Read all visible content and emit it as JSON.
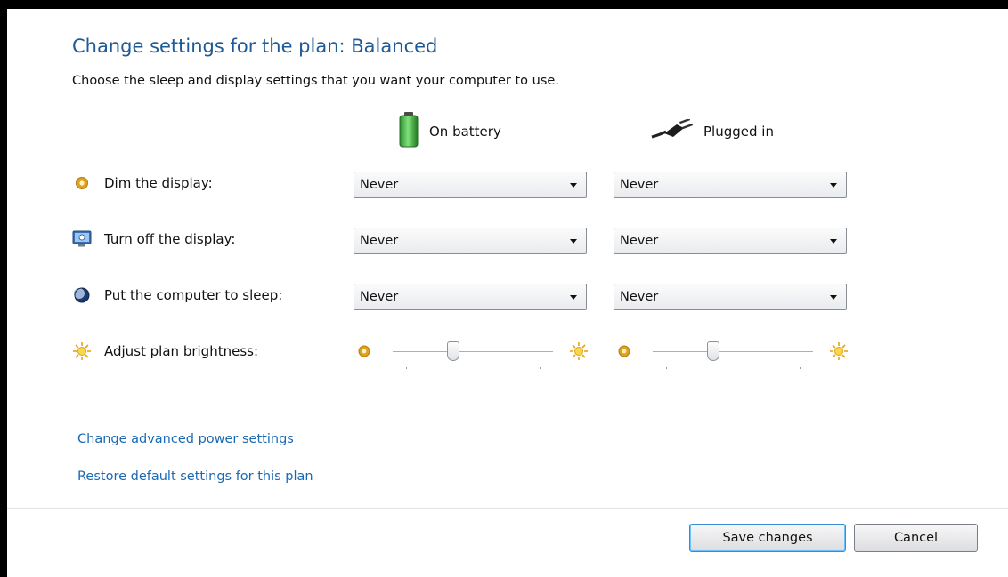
{
  "header": {
    "title": "Change settings for the plan: Balanced",
    "subtitle": "Choose the sleep and display settings that you want your computer to use."
  },
  "columns": {
    "battery": {
      "label": "On battery",
      "icon": "battery-icon"
    },
    "plugged": {
      "label": "Plugged in",
      "icon": "power-plug-icon"
    }
  },
  "rows": [
    {
      "label": "Dim the display:",
      "icon": "dim-display-icon",
      "battery_value": "Never",
      "plugged_value": "Never"
    },
    {
      "label": "Turn off the display:",
      "icon": "monitor-icon",
      "battery_value": "Never",
      "plugged_value": "Never"
    },
    {
      "label": "Put the computer to sleep:",
      "icon": "sleep-moon-icon",
      "battery_value": "Never",
      "plugged_value": "Never"
    }
  ],
  "brightness": {
    "label": "Adjust plan brightness:",
    "icon": "sun-icon",
    "battery_level": 0.38,
    "plugged_level": 0.38
  },
  "links": {
    "advanced": "Change advanced power settings",
    "restore": "Restore default settings for this plan"
  },
  "buttons": {
    "save": "Save changes",
    "cancel": "Cancel"
  },
  "colors": {
    "title": "#1e5a96",
    "link": "#1a69b3",
    "battery_green": "#34b233",
    "sun": "#e8a317"
  }
}
